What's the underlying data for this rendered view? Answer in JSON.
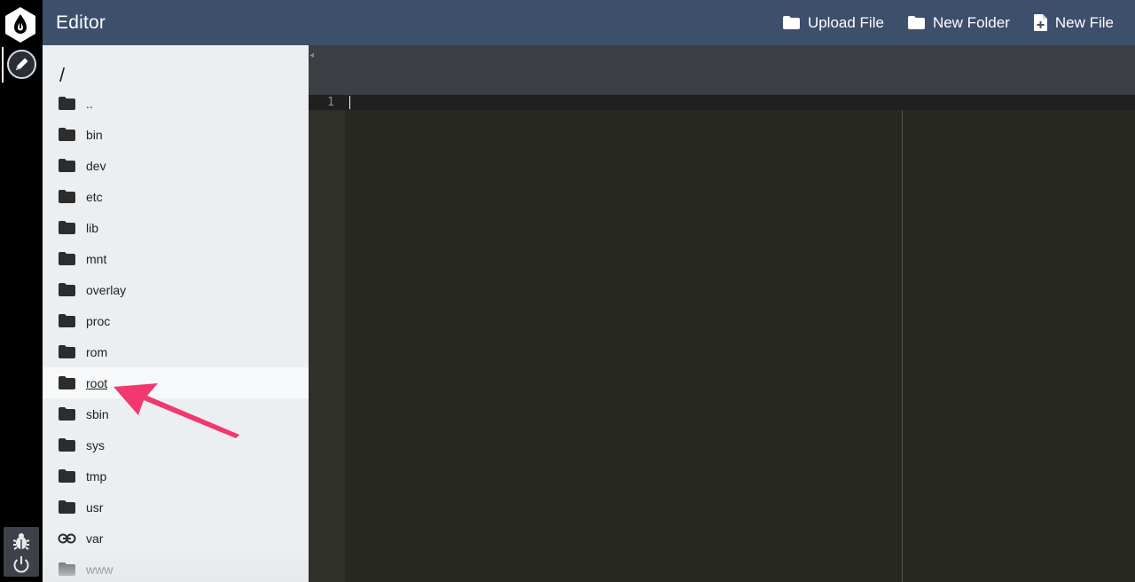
{
  "header": {
    "title": "Editor",
    "actions": [
      {
        "label": "Upload File",
        "icon": "folder-icon"
      },
      {
        "label": "New Folder",
        "icon": "folder-icon"
      },
      {
        "label": "New File",
        "icon": "file-plus-icon"
      }
    ]
  },
  "files": {
    "path": "/",
    "items": [
      {
        "name": "..",
        "icon": "folder-icon"
      },
      {
        "name": "bin",
        "icon": "folder-icon"
      },
      {
        "name": "dev",
        "icon": "folder-icon"
      },
      {
        "name": "etc",
        "icon": "folder-icon"
      },
      {
        "name": "lib",
        "icon": "folder-icon"
      },
      {
        "name": "mnt",
        "icon": "folder-icon"
      },
      {
        "name": "overlay",
        "icon": "folder-icon"
      },
      {
        "name": "proc",
        "icon": "folder-icon"
      },
      {
        "name": "rom",
        "icon": "folder-icon"
      },
      {
        "name": "root",
        "icon": "folder-icon",
        "selected": true
      },
      {
        "name": "sbin",
        "icon": "folder-icon"
      },
      {
        "name": "sys",
        "icon": "folder-icon"
      },
      {
        "name": "tmp",
        "icon": "folder-icon"
      },
      {
        "name": "usr",
        "icon": "folder-icon"
      },
      {
        "name": "var",
        "icon": "link-icon"
      },
      {
        "name": "www",
        "icon": "folder-icon"
      }
    ]
  },
  "editor": {
    "line_number": "1"
  },
  "colors": {
    "header_bg": "#3c4f6b",
    "panel_bg": "#eceff1",
    "editor_bg": "#272822",
    "annotation_arrow": "#f2386f"
  }
}
